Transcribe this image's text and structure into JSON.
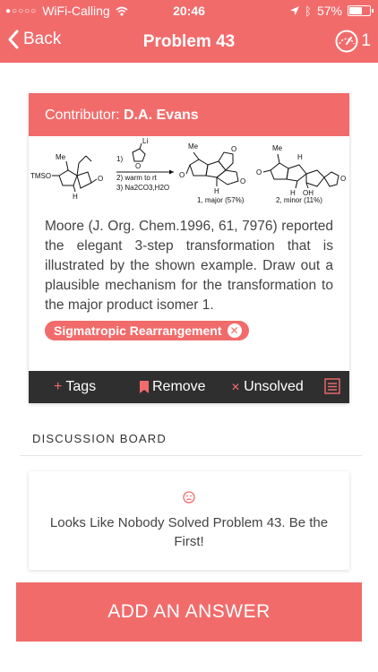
{
  "status_bar": {
    "carrier": "WiFi-Calling",
    "time": "20:46",
    "battery": "57%"
  },
  "nav": {
    "back_label": "Back",
    "title": "Problem 43",
    "meter_count": "1"
  },
  "problem": {
    "contributor_prefix": "Contributor: ",
    "contributor_name": "D.A. Evans",
    "scheme": {
      "reactant_labels": {
        "me": "Me",
        "tmso": "TMSO",
        "o": "O",
        "h": "H"
      },
      "reagents": [
        "1)",
        "2)  warm to rt",
        "3)  Na2CO3,H2O"
      ],
      "reagent_li": "Li",
      "reagent_o": "O",
      "product1_label": "1, major (57%)",
      "product2_label": "2, minor (11%)",
      "product1_atoms": {
        "me": "Me",
        "o1": "O",
        "o2": "O",
        "o3": "O",
        "h": "H"
      },
      "product2_atoms": {
        "me": "Me",
        "o1": "O",
        "o2": "O",
        "h1": "H",
        "h2": "H",
        "oh": "OH"
      }
    },
    "text": "Moore (J. Org. Chem.1996, 61, 7976) reported the elegant 3-step transformation that is illustrated by the shown example. Draw out a plausible mechanism for the transformation to the major product isomer 1.",
    "tag": "Sigmatropic Rearrangement",
    "toolbar": {
      "tags_label": "Tags",
      "remove_label": "Remove",
      "unsolved_label": "Unsolved"
    }
  },
  "discussion": {
    "section_label": "DISCUSSION BOARD",
    "empty_message": "Looks Like Nobody Solved Problem 43. Be the First!"
  },
  "add_answer_label": "ADD AN ANSWER",
  "colors": {
    "accent": "#f26b6b",
    "toolbar": "#2f2f2f"
  }
}
